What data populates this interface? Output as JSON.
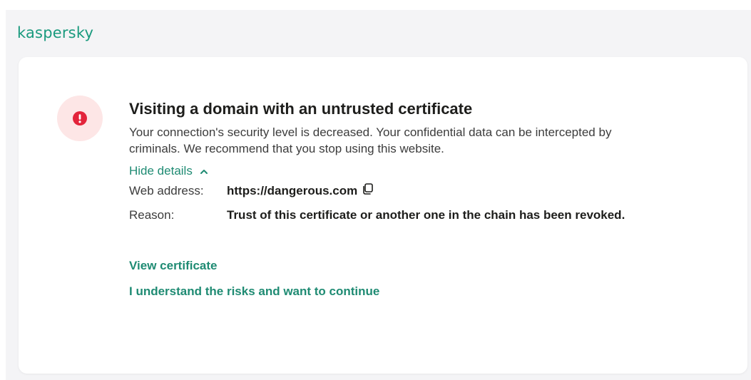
{
  "brand": {
    "logo_text": "kaspersky",
    "accent_color": "#1a9a7e",
    "link_color": "#1f8b73",
    "alert_color": "#e3243b"
  },
  "warning": {
    "icon": "exclamation-icon",
    "title": "Visiting a domain with an untrusted certificate",
    "description": "Your connection's security level is decreased. Your confidential data can be intercepted by criminals. We recommend that you stop using this website.",
    "details_toggle_label": "Hide details",
    "details": {
      "web_address_label": "Web address:",
      "web_address_value": "https://dangerous.com",
      "reason_label": "Reason:",
      "reason_value": "Trust of this certificate or another one in the chain has been revoked."
    }
  },
  "actions": {
    "view_certificate": "View certificate",
    "continue": "I understand the risks and want to continue"
  }
}
